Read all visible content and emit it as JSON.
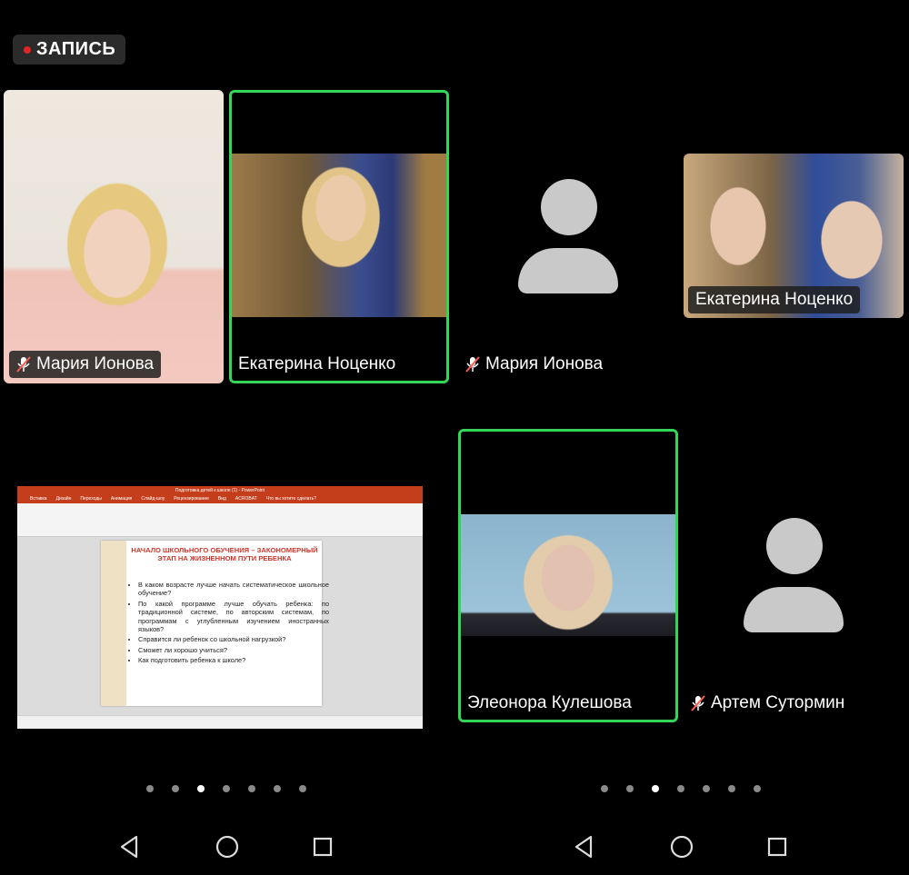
{
  "recording": {
    "label": "ЗАПИСЬ",
    "dot_color": "#e02525"
  },
  "left_page": {
    "tiles": [
      {
        "name": "Мария Ионова",
        "muted": true
      },
      {
        "name": "Екатерина Ноценко",
        "muted": false,
        "active": true
      }
    ]
  },
  "right_page": {
    "tiles": [
      {
        "name": "Мария Ионова",
        "muted": true
      },
      {
        "name": "Екатерина Ноценко",
        "muted": false
      }
    ]
  },
  "bottom_left": {
    "shared_screen": {
      "app_title": "Подготовка детей к школе (1) - PowerPoint",
      "menu": [
        "Вставка",
        "Дизайн",
        "Переходы",
        "Анимация",
        "Слайд-шоу",
        "Рецензирование",
        "Вид",
        "ACROBAT",
        "Что вы хотите сделать?"
      ],
      "slide_title": "НАЧАЛО ШКОЛЬНОГО ОБУЧЕНИЯ – ЗАКОНОМЕРНЫЙ ЭТАП НА ЖИЗНЕННОМ ПУТИ РЕБЕНКА",
      "bullets": [
        "В каком возрасте лучше начать систематическое школьное обучение?",
        "По какой программе лучше обучать ребенка: по традиционной системе, по авторским системам, по программам с углубленным изучением иностранных языков?",
        "Справится ли ребенок со школьной нагрузкой?",
        "Сможет ли хорошо учиться?",
        "Как подготовить ребенка к школе?"
      ]
    }
  },
  "bottom_right": {
    "tiles": [
      {
        "name": "Элеонора Кулешова",
        "muted": false,
        "active": true
      },
      {
        "name": "Артем Сутормин",
        "muted": true
      }
    ]
  },
  "pager": {
    "count": 7,
    "active_index": 2
  },
  "android_nav": [
    "back-button",
    "home-button",
    "recents-button"
  ],
  "colors": {
    "active_border": "#35d45a",
    "avatar": "#c9c9c9",
    "muted_icon": "#ff5a4e"
  }
}
